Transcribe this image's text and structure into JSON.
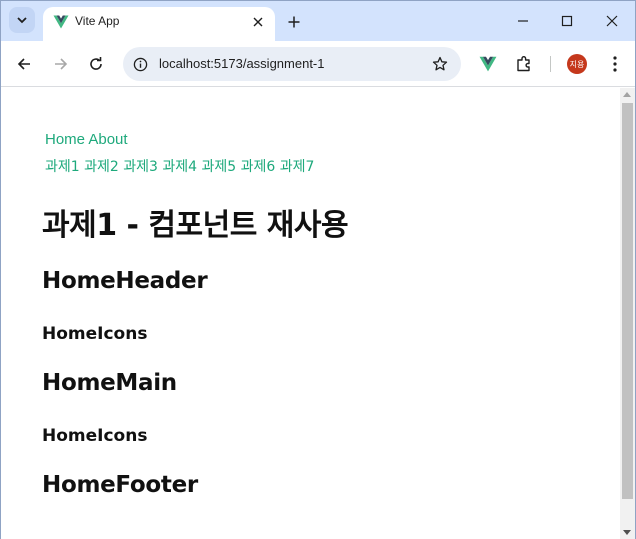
{
  "browser": {
    "tab": {
      "title": "Vite App"
    },
    "address": {
      "url": "localhost:5173/assignment-1"
    },
    "profile": {
      "initials": "지용",
      "color": "#c5381c"
    }
  },
  "page": {
    "nav": {
      "links": [
        "Home",
        "About"
      ]
    },
    "subnav": {
      "links": [
        "과제1",
        "과제2",
        "과제3",
        "과제4",
        "과제5",
        "과제6",
        "과제7"
      ]
    },
    "title": "과제1 - 컴포넌트 재사용",
    "sections": {
      "home_header": "HomeHeader",
      "home_icons_1": "HomeIcons",
      "home_main": "HomeMain",
      "home_icons_2": "HomeIcons",
      "home_footer": "HomeFooter"
    }
  },
  "colors": {
    "link": "#1ea97c",
    "tabstrip": "#d3e3fd",
    "omnibox": "#e9eef6"
  },
  "icons": [
    "tab-search-icon",
    "vue-icon",
    "close-icon",
    "plus-icon",
    "minimize-icon",
    "maximize-icon",
    "window-close-icon",
    "back-icon",
    "forward-icon",
    "reload-icon",
    "info-icon",
    "star-icon",
    "vue-devtools-icon",
    "extensions-icon"
  ]
}
